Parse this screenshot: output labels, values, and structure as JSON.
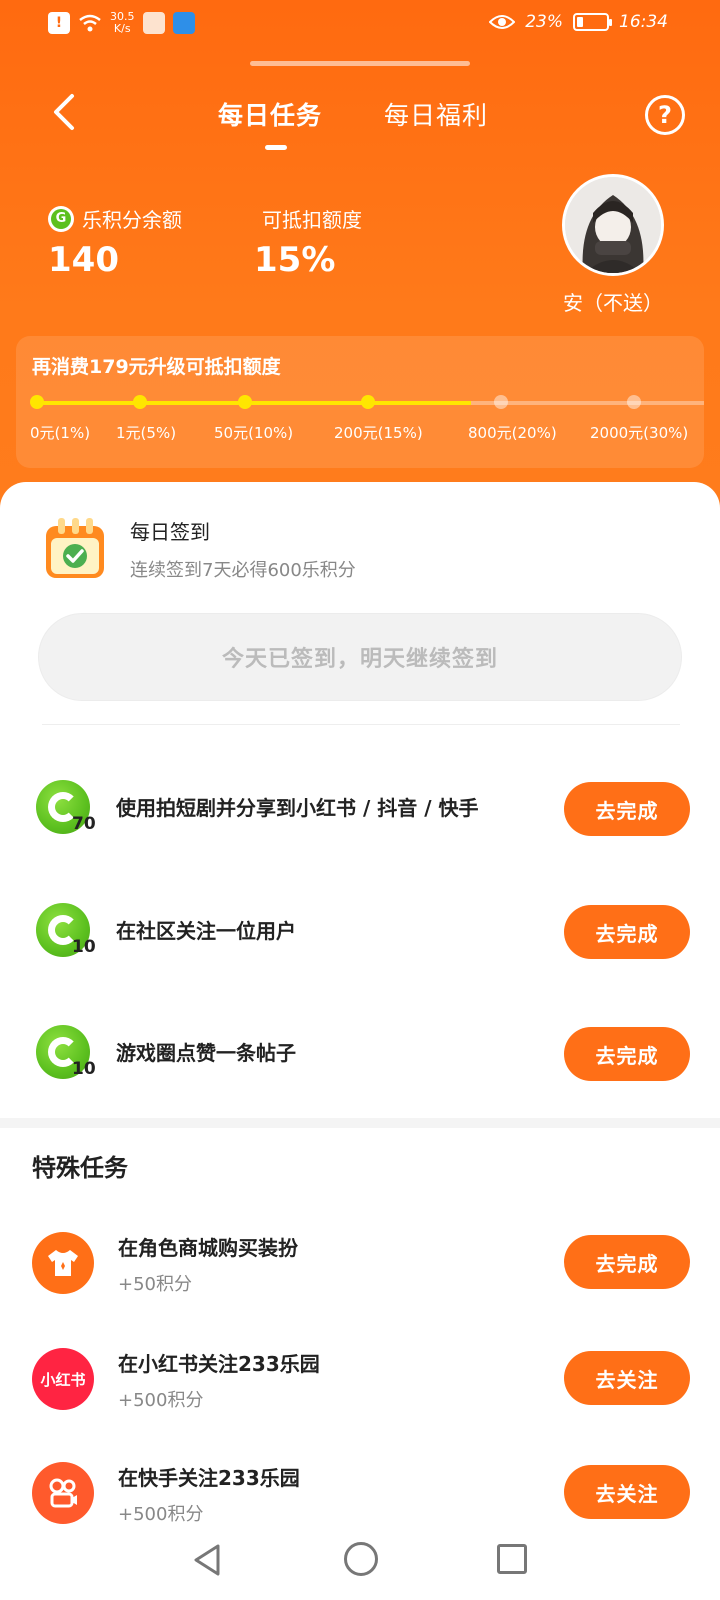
{
  "status_bar": {
    "speed": "30.5",
    "speed_unit": "K/s",
    "battery": "23%",
    "battery_level": 0.23,
    "time": "16:34"
  },
  "header": {
    "tabs": [
      {
        "label": "每日任务"
      },
      {
        "label": "每日福利"
      }
    ],
    "active_tab": 0
  },
  "balance": {
    "points_label": "乐积分余额",
    "points_value": "140",
    "deduct_label": "可抵扣额度",
    "deduct_value": "15%"
  },
  "user": {
    "name": "安（不送）"
  },
  "upgrade": {
    "title": "再消费179元升级可抵扣额度",
    "levels": [
      "0元(1%)",
      "1元(5%)",
      "50元(10%)",
      "200元(15%)",
      "800元(20%)",
      "2000元(30%)"
    ],
    "current_level": 3
  },
  "signin": {
    "title": "每日签到",
    "subtitle": "连续签到7天必得600乐积分",
    "button_label": "今天已签到，明天继续签到"
  },
  "daily_tasks": [
    {
      "points": "70",
      "title": "使用拍短剧并分享到小红书 / 抖音 / 快手",
      "button": "去完成"
    },
    {
      "points": "10",
      "title": "在社区关注一位用户",
      "button": "去完成"
    },
    {
      "points": "10",
      "title": "游戏圈点赞一条帖子",
      "button": "去完成"
    }
  ],
  "special": {
    "heading": "特殊任务",
    "items": [
      {
        "icon": "shirt-icon",
        "title": "在角色商城购买装扮",
        "desc": "+50积分",
        "button": "去完成",
        "color": "#ff6f17"
      },
      {
        "icon": "xiaohongshu-logo",
        "logo_text": "小红书",
        "title": "在小红书关注233乐园",
        "desc": "+500积分",
        "button": "去关注",
        "color": "#ff2442"
      },
      {
        "icon": "kuaishou-logo",
        "title": "在快手关注233乐园",
        "desc": "+500积分",
        "button": "去关注",
        "color": "#ff5a2c"
      }
    ]
  },
  "colors": {
    "accent": "#ff6f17",
    "header_bg": "#ff6a10",
    "progress": "#ffe600",
    "badge_green": "#5cc01f"
  }
}
